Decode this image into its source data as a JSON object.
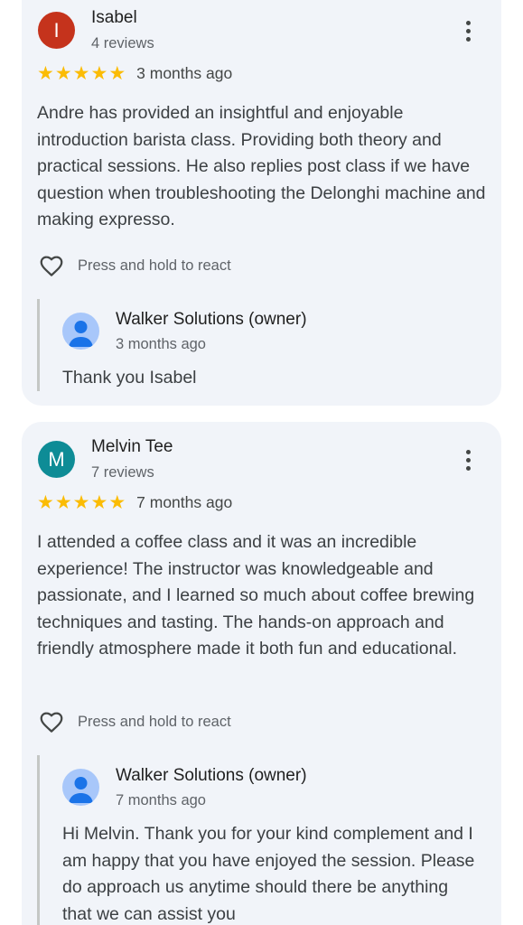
{
  "reviews": [
    {
      "avatar_letter": "I",
      "avatar_color": "#c5331c",
      "name": "Isabel",
      "review_count": "4 reviews",
      "stars": "★★★★★",
      "date": "3 months ago",
      "text": "Andre has provided an insightful and enjoyable introduction barista class. Providing both theory and practical sessions. He also replies post class if we have question when troubleshooting the Delonghi machine and making expresso.",
      "react_label": "Press and hold to react",
      "reply": {
        "owner_name": "Walker Solutions (owner)",
        "date": "3 months ago",
        "text": "Thank you Isabel"
      }
    },
    {
      "avatar_letter": "M",
      "avatar_color": "#0e8c96",
      "name": "Melvin Tee",
      "review_count": "7 reviews",
      "stars": "★★★★★",
      "date": "7 months ago",
      "text": "I attended a coffee class and it was an incredible experience! The instructor was knowledgeable and passionate, and I learned so much about coffee brewing techniques and tasting. The hands-on approach and friendly atmosphere made it both fun and educational.",
      "react_label": "Press and hold to react",
      "reply": {
        "owner_name": "Walker Solutions (owner)",
        "date": "7 months ago",
        "text": "Hi Melvin. Thank you for your kind complement and I am happy that you have enjoyed the session. Please do approach us anytime should there be anything that we can assist you"
      }
    }
  ],
  "colors": {
    "card_bg": "#f1f4f9",
    "star": "#fbbc04",
    "owner_avatar_bg": "#a8c7fa",
    "owner_avatar_fg": "#1a73e8"
  },
  "icons": {
    "more": "more-vert-icon",
    "react": "heart-outline-icon",
    "owner_avatar": "person-icon"
  }
}
